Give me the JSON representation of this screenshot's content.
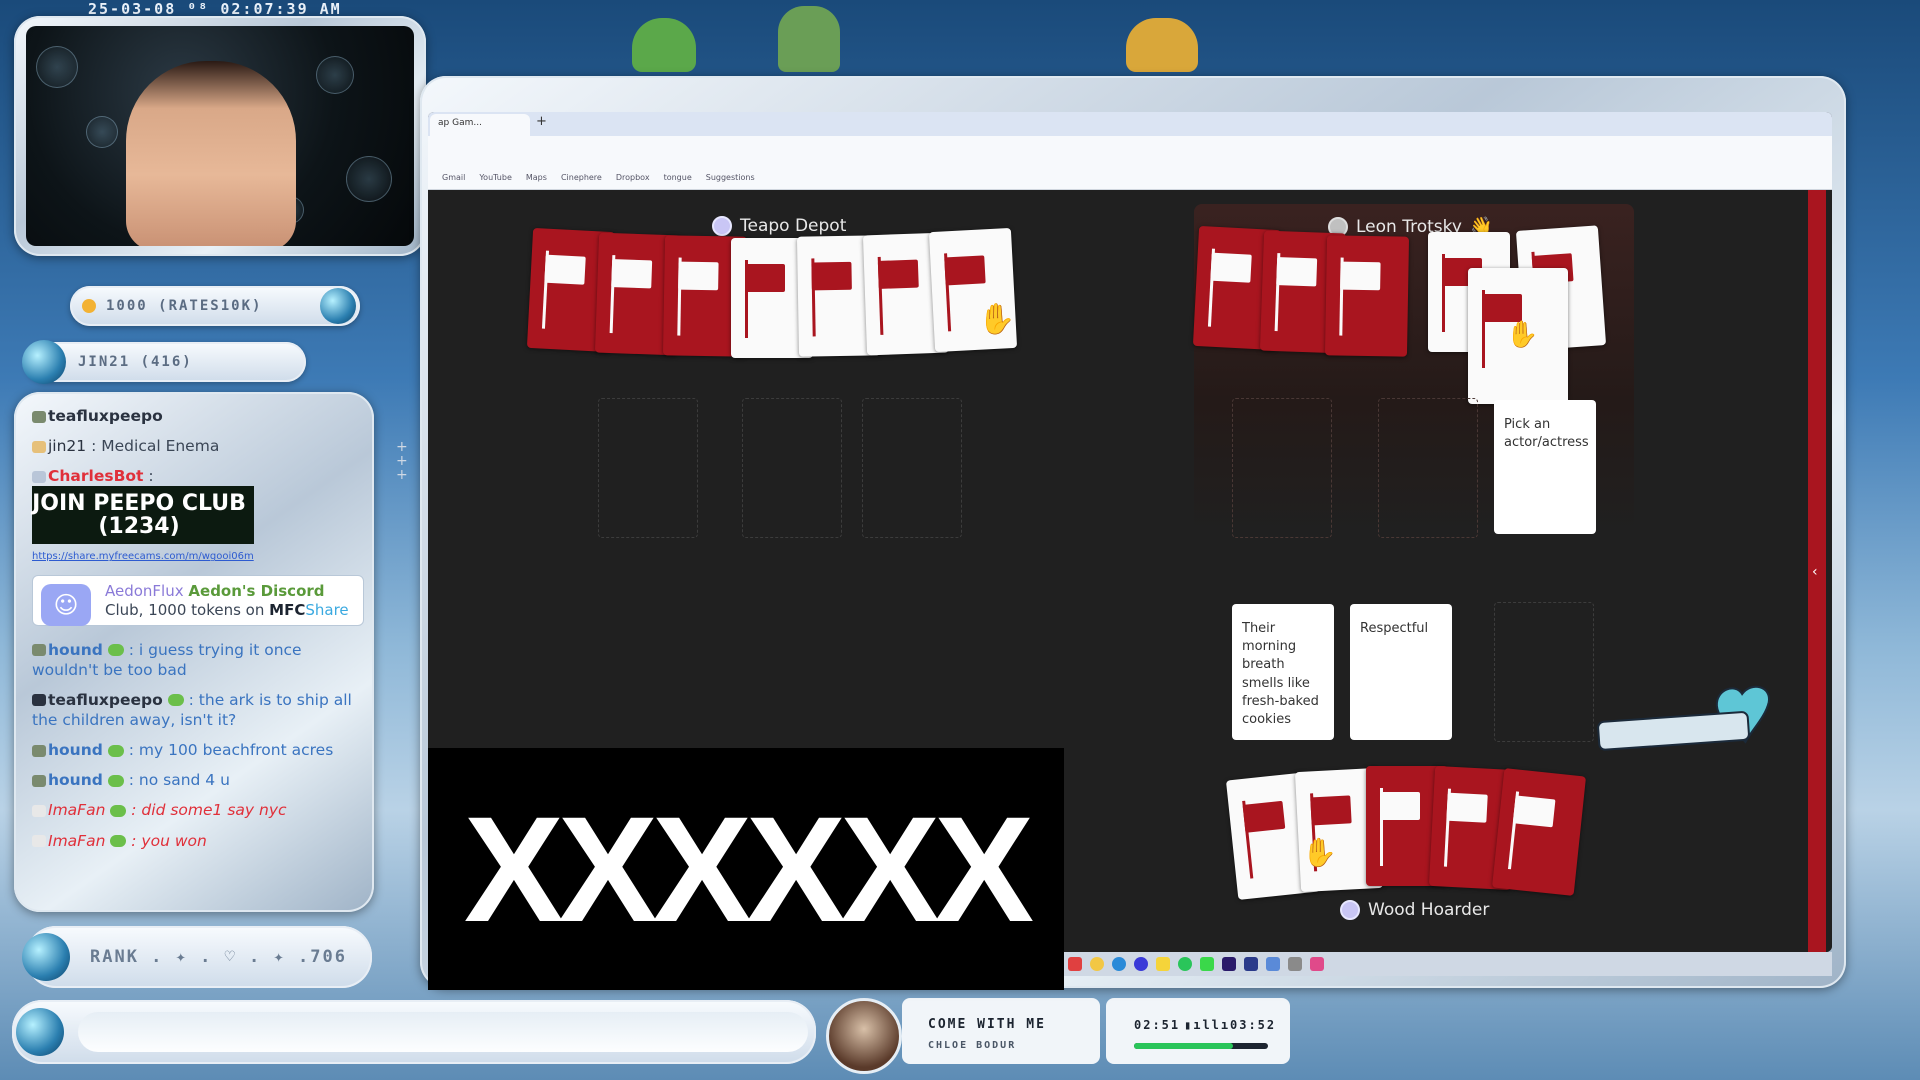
{
  "overlay": {
    "timestamp": "25-03-08 ⁰⁸ 02:07:39 AM",
    "tokens_pill": "1000 (RATES10K)",
    "jin_pill": "JIN21 (416)",
    "rank": "RANK . ✦ . ♡ . ✦ .706"
  },
  "chat": {
    "lines": [
      {
        "user": "teafluxpeepo",
        "msg": ""
      },
      {
        "user": "jin21",
        "msg": ": Medical Enema"
      },
      {
        "user": "CharlesBot",
        "msg": ":"
      },
      {
        "user": "AedonFlux",
        "msg": "Aedon's Discord",
        "extra": " Club, 1000 tokens on",
        "brand": "MFC",
        "brand2": "Share"
      },
      {
        "user": "hound",
        "msg": ": i guess trying it once wouldn't be too bad"
      },
      {
        "user": "teafluxpeepo",
        "msg": ": the ark is to ship all the children away, isn't it?"
      },
      {
        "user": "hound",
        "msg": ": my 100 beachfront acres"
      },
      {
        "user": "hound",
        "msg": ": no sand 4 u"
      },
      {
        "user": "ImaFan",
        "msg": ": did some1 say nyc"
      },
      {
        "user": "ImaFan",
        "msg": ": you won"
      }
    ],
    "banner": "JOIN PEEPO CLUB (1234)",
    "link": "https://share.myfreecams.com/m/wgooi06m"
  },
  "music": {
    "title": "COME WITH ME",
    "artist": "CHLOE BODUR",
    "time_current": "02:51",
    "time_total": "03:52",
    "progress": 0.74
  },
  "browser": {
    "tab_label": "ap Gam...",
    "bookmarks": [
      "Gmail",
      "YouTube",
      "Maps",
      "Cinephere",
      "Dropbox",
      "tongue",
      "Suggestions"
    ]
  },
  "game": {
    "players": {
      "p1": "Teapo Depot",
      "p2": "Leon Trotsky",
      "p3": "Wood Hoarder"
    },
    "prompt_card": "Pick an actor/actress",
    "answers": [
      "Their morning breath smells like fresh-baked cookies",
      "Respectful"
    ]
  },
  "censor_text": "XXXXXX",
  "logo_text": "AedonFlux",
  "colors": {
    "card_red": "#a9151f",
    "game_bg": "#202020",
    "accent_blue": "#3a74c0"
  }
}
